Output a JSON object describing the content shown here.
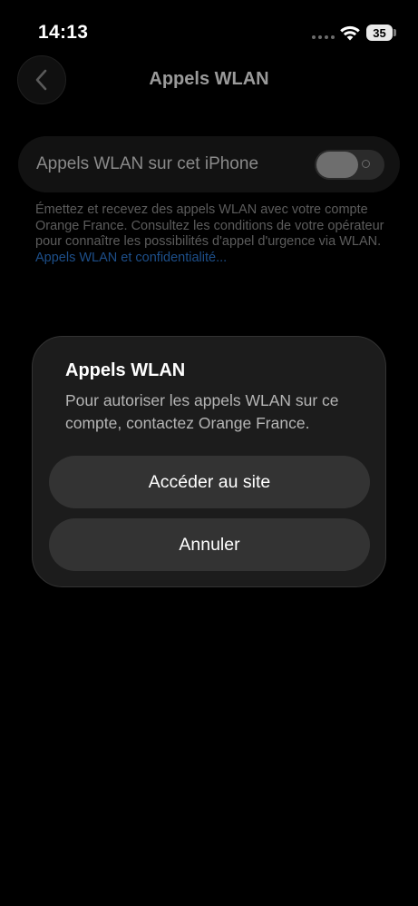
{
  "status_bar": {
    "time": "14:13",
    "battery_level": "35",
    "icons": [
      "cellular-dots-icon",
      "wifi-icon",
      "battery-icon"
    ]
  },
  "nav": {
    "title": "Appels WLAN",
    "back_icon": "chevron-left-icon"
  },
  "setting": {
    "label": "Appels WLAN sur cet iPhone",
    "toggle_state": "off"
  },
  "footer": {
    "text": "Émettez et recevez des appels WLAN avec votre compte Orange France. Consultez les conditions de votre opérateur pour connaître les possibilités d'appel d'urgence via WLAN. ",
    "link": "Appels WLAN et confidentialité..."
  },
  "alert": {
    "title": "Appels WLAN",
    "message": "Pour autoriser les appels WLAN sur ce compte, contactez Orange France.",
    "primary_button": "Accéder au site",
    "cancel_button": "Annuler"
  },
  "colors": {
    "background": "#000000",
    "alert_background": "#1c1c1c",
    "button_background": "#333333",
    "link": "#1d4f8a"
  }
}
